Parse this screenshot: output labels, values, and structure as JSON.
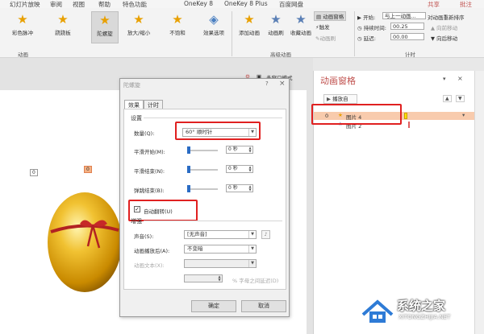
{
  "menubar": {
    "items": [
      "幻灯片放映",
      "审阅",
      "视图",
      "帮助",
      "特色功能",
      "OneKey 8",
      "OneKey 8 Plus",
      "百度网盘"
    ],
    "share": "共享",
    "comment": "批注"
  },
  "ribbon": {
    "effects": [
      {
        "label": "彩色脉冲",
        "icon": "star-icon"
      },
      {
        "label": "跷跷板",
        "icon": "star-icon"
      },
      {
        "label": "陀螺旋",
        "icon": "star-icon"
      },
      {
        "label": "放大/缩小",
        "icon": "star-icon"
      },
      {
        "label": "不饱和",
        "icon": "star-icon"
      }
    ],
    "effect_options": "效果选项",
    "group_animation": "动画",
    "add_animation": "添加动画",
    "animation_painter": "动画刷",
    "adv_label": "高级动画",
    "trigger": "触发",
    "painter2": "动画刷",
    "pane_toggle": "动画窗格",
    "start_label": "开始:",
    "start_value": "与上一动画...",
    "duration_label": "持续时间:",
    "duration_value": "00.25",
    "delay_label": "延迟:",
    "delay_value": "00.00",
    "timing_label": "计时",
    "reorder_title": "对动画重新排序",
    "move_earlier": "向前移动",
    "move_later": "向后移动",
    "mode_label": "多窗口模式"
  },
  "dialog": {
    "title": "陀螺旋",
    "help": "?",
    "close": "×",
    "tabs": [
      "效果",
      "计时"
    ],
    "section_settings": "设置",
    "amount_label": "数量(Q):",
    "amount_value": "60° 顺时针",
    "smooth_start_label": "平滑开始(M):",
    "smooth_start_value": "0 秒",
    "smooth_end_label": "平滑结束(N):",
    "smooth_end_value": "0 秒",
    "bounce_end_label": "弹跳结束(B):",
    "bounce_end_value": "0 秒",
    "auto_reverse_label": "自动翻转(U)",
    "auto_reverse_checked": true,
    "section_enhance": "增强",
    "sound_label": "声音(S):",
    "sound_value": "[无声音]",
    "after_label": "动画播放后(A):",
    "after_value": "不变暗",
    "text_label": "动画文本(X):",
    "text_value": "",
    "delay_pct_label": "% 字母之间延迟(D)",
    "ok": "确定",
    "cancel": "取消"
  },
  "pane": {
    "title": "动画窗格",
    "play_from": "播放自",
    "rows": [
      {
        "index": "0",
        "name": "图片 4"
      },
      {
        "index": "",
        "name": "图片 2"
      }
    ]
  },
  "slide_tags": [
    "0",
    "0"
  ],
  "watermark": {
    "text": "系统之家",
    "url": "XITONGZHIJIA.NET"
  },
  "colors": {
    "accent_red": "#e02020",
    "pane_title": "#c0504d",
    "highlight_row": "#f4b183",
    "slider_blue": "#2b6cc4"
  }
}
